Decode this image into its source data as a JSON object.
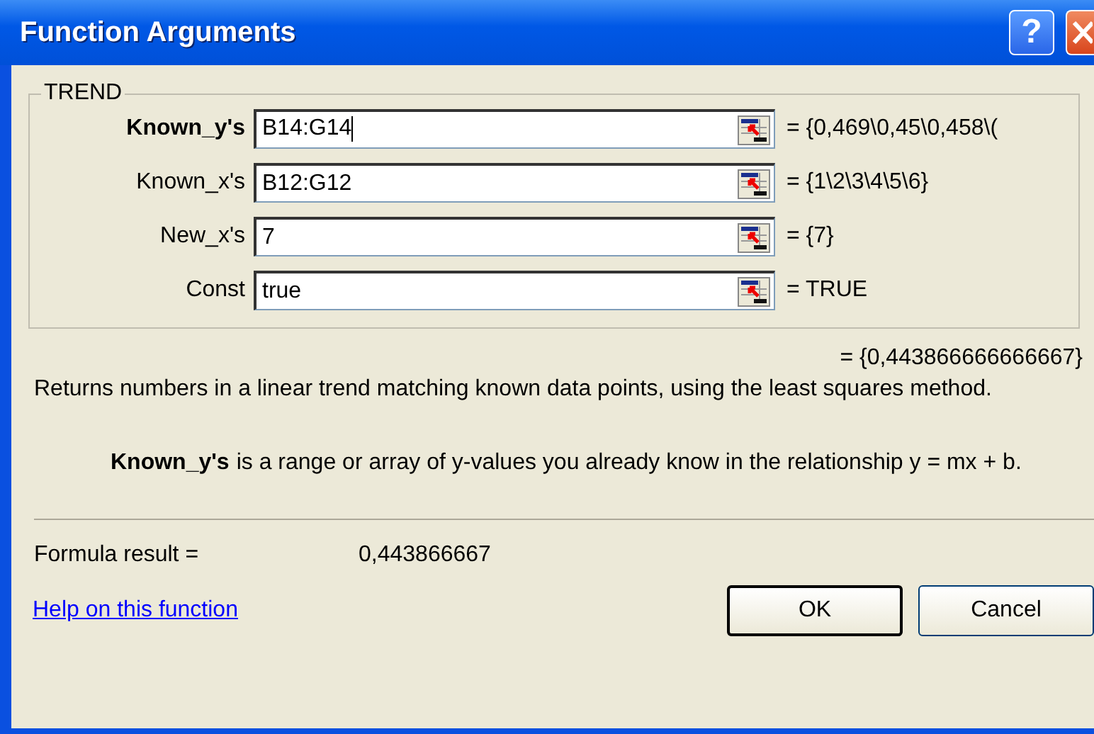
{
  "window": {
    "title": "Function Arguments",
    "help_button": "?"
  },
  "group": {
    "title": "TREND",
    "args": [
      {
        "label": "Known_y's",
        "value": "B14:G14",
        "result": "= {0,469\\0,45\\0,458\\(",
        "selected": true
      },
      {
        "label": "Known_x's",
        "value": "B12:G12",
        "result": "= {1\\2\\3\\4\\5\\6}",
        "selected": false
      },
      {
        "label": "New_x's",
        "value": "7",
        "result": "= {7}",
        "selected": false
      },
      {
        "label": "Const",
        "value": "true",
        "result": "= TRUE",
        "selected": false
      }
    ]
  },
  "overall_result": "= {0,443866666666667}",
  "description": "Returns numbers in a linear trend matching known data points, using the least squares method.",
  "arg_help": {
    "name": "Known_y's",
    "text": "is a range or array of y-values you already know in the relationship y = mx + b."
  },
  "formula_result": {
    "label": "Formula result =",
    "value": "0,443866667"
  },
  "help_link": "Help on this function",
  "buttons": [
    "OK",
    "Cancel"
  ]
}
